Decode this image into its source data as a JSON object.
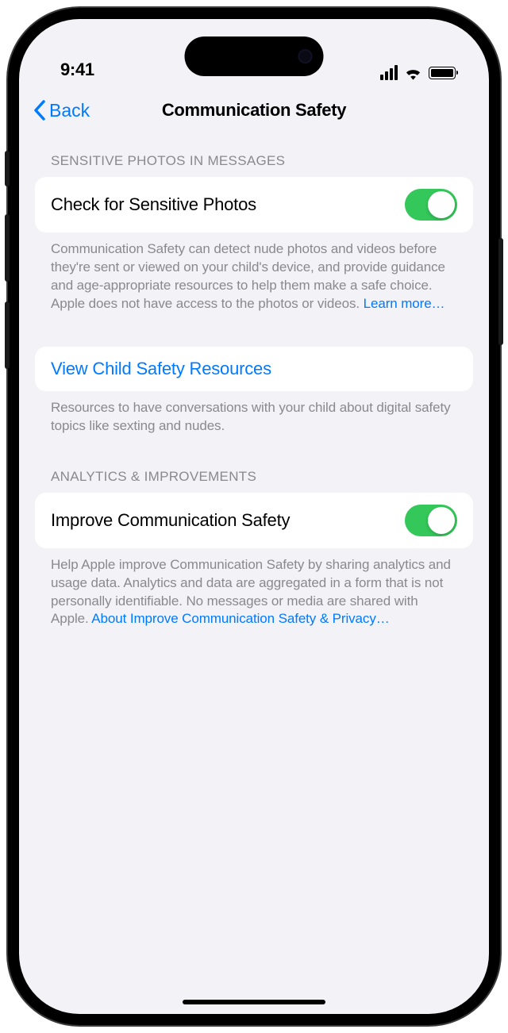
{
  "status": {
    "time": "9:41"
  },
  "nav": {
    "back_label": "Back",
    "title": "Communication Safety"
  },
  "section1": {
    "header": "SENSITIVE PHOTOS IN MESSAGES",
    "toggle_label": "Check for Sensitive Photos",
    "toggle_on": true,
    "footer_text": "Communication Safety can detect nude photos and videos before they're sent or viewed on your child's device, and provide guidance and age-appropriate resources to help them make a safe choice. Apple does not have access to the photos or videos. ",
    "footer_link": "Learn more…"
  },
  "section2": {
    "link_label": "View Child Safety Resources",
    "footer_text": "Resources to have conversations with your child about digital safety topics like sexting and nudes."
  },
  "section3": {
    "header": "ANALYTICS & IMPROVEMENTS",
    "toggle_label": "Improve Communication Safety",
    "toggle_on": true,
    "footer_text": "Help Apple improve Communication Safety by sharing analytics and usage data. Analytics and data are aggregated in a form that is not personally identifiable. No messages or media are shared with Apple. ",
    "footer_link": "About Improve Communication Safety & Privacy…"
  }
}
